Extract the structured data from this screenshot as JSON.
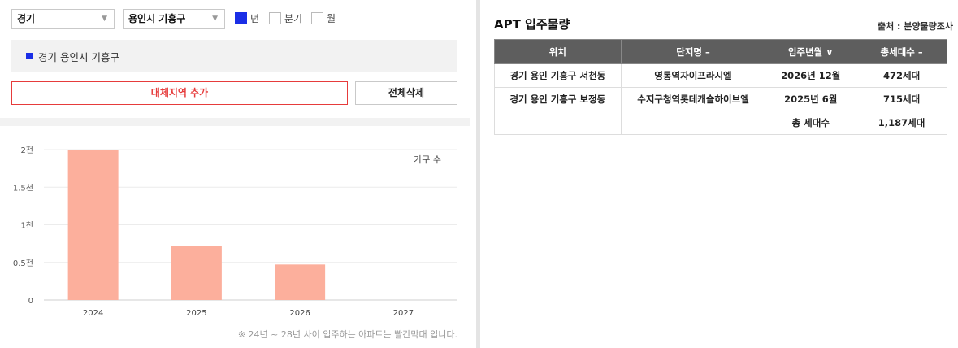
{
  "filters": {
    "region": "경기",
    "subregion": "용인시 기흥구",
    "period_options": [
      {
        "label": "년",
        "checked": true
      },
      {
        "label": "분기",
        "checked": false
      },
      {
        "label": "월",
        "checked": false
      }
    ]
  },
  "selected_region": "경기 용인시 기흥구",
  "buttons": {
    "add_alternative": "대체지역 추가",
    "clear_all": "전체삭제"
  },
  "chart_data": {
    "type": "bar",
    "categories": [
      "2024",
      "2025",
      "2026",
      "2027"
    ],
    "values": [
      2000,
      715,
      472,
      0
    ],
    "ylim": [
      0,
      2000
    ],
    "yticks": [
      {
        "value": 0,
        "label": "0"
      },
      {
        "value": 500,
        "label": "0.5천"
      },
      {
        "value": 1000,
        "label": "1천"
      },
      {
        "value": 1500,
        "label": "1.5천"
      },
      {
        "value": 2000,
        "label": "2천"
      }
    ],
    "legend": "가구 수",
    "legend_position": "top-right",
    "grid": true,
    "bar_color": "#fcaf9c"
  },
  "footnote": "※ 24년 ~ 28년 사이 입주하는 아파트는 빨간막대 입니다.",
  "apt": {
    "title": "APT 입주물량",
    "source": "출처 : 분양물량조사",
    "headers": [
      "위치",
      "단지명 –",
      "입주년월 ∨",
      "총세대수 –"
    ],
    "rows": [
      [
        "경기 용인 기흥구 서천동",
        "영통역자이프라시엘",
        "2026년 12월",
        "472세대"
      ],
      [
        "경기 용인 기흥구 보정동",
        "수지구청역롯데캐슬하이브엘",
        "2025년 6월",
        "715세대"
      ],
      [
        "",
        "",
        "총 세대수",
        "1,187세대"
      ]
    ]
  }
}
